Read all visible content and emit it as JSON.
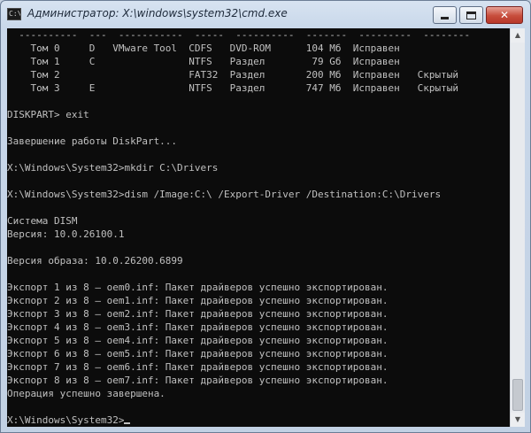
{
  "window": {
    "title": "Администратор: X:\\windows\\system32\\cmd.exe",
    "icon_text": "C:\\"
  },
  "icons": {
    "app": "command-prompt-icon",
    "minimize": "minimize-icon",
    "maximize": "maximize-icon",
    "close": "close-icon",
    "scroll_up": "arrow-up-icon",
    "scroll_down": "arrow-down-icon"
  },
  "glyphs": {
    "close": "✕",
    "scroll_up": "▲",
    "scroll_down": "▼"
  },
  "colors": {
    "console_background": "#0c0c0c",
    "console_text": "#c0c0c0",
    "close_button": "#c74d3c"
  },
  "console": {
    "lines": [
      "  ----------  ---  -----------  -----  ----------  -------  ---------  --------",
      "    Том 0     D   VMware Tool  CDFS   DVD-ROM      104 Мб  Исправен",
      "    Том 1     C                NTFS   Раздел        79 Gб  Исправен",
      "    Том 2                      FAT32  Раздел       200 Мб  Исправен   Скрытый",
      "    Том 3     E                NTFS   Раздел       747 Мб  Исправен   Скрытый",
      "",
      "DISKPART> exit",
      "",
      "Завершение работы DiskPart...",
      "",
      "X:\\Windows\\System32>mkdir C:\\Drivers",
      "",
      "X:\\Windows\\System32>dism /Image:C:\\ /Export-Driver /Destination:C:\\Drivers",
      "",
      "Система DISM",
      "Версия: 10.0.26100.1",
      "",
      "Версия образа: 10.0.26200.6899",
      "",
      "Экспорт 1 из 8 — oem0.inf: Пакет драйверов успешно экспортирован.",
      "Экспорт 2 из 8 — oem1.inf: Пакет драйверов успешно экспортирован.",
      "Экспорт 3 из 8 — oem2.inf: Пакет драйверов успешно экспортирован.",
      "Экспорт 4 из 8 — oem3.inf: Пакет драйверов успешно экспортирован.",
      "Экспорт 5 из 8 — oem4.inf: Пакет драйверов успешно экспортирован.",
      "Экспорт 6 из 8 — oem5.inf: Пакет драйверов успешно экспортирован.",
      "Экспорт 7 из 8 — oem6.inf: Пакет драйверов успешно экспортирован.",
      "Экспорт 8 из 8 — oem7.inf: Пакет драйверов успешно экспортирован.",
      "Операция успешно завершена.",
      "",
      "X:\\Windows\\System32>"
    ]
  }
}
